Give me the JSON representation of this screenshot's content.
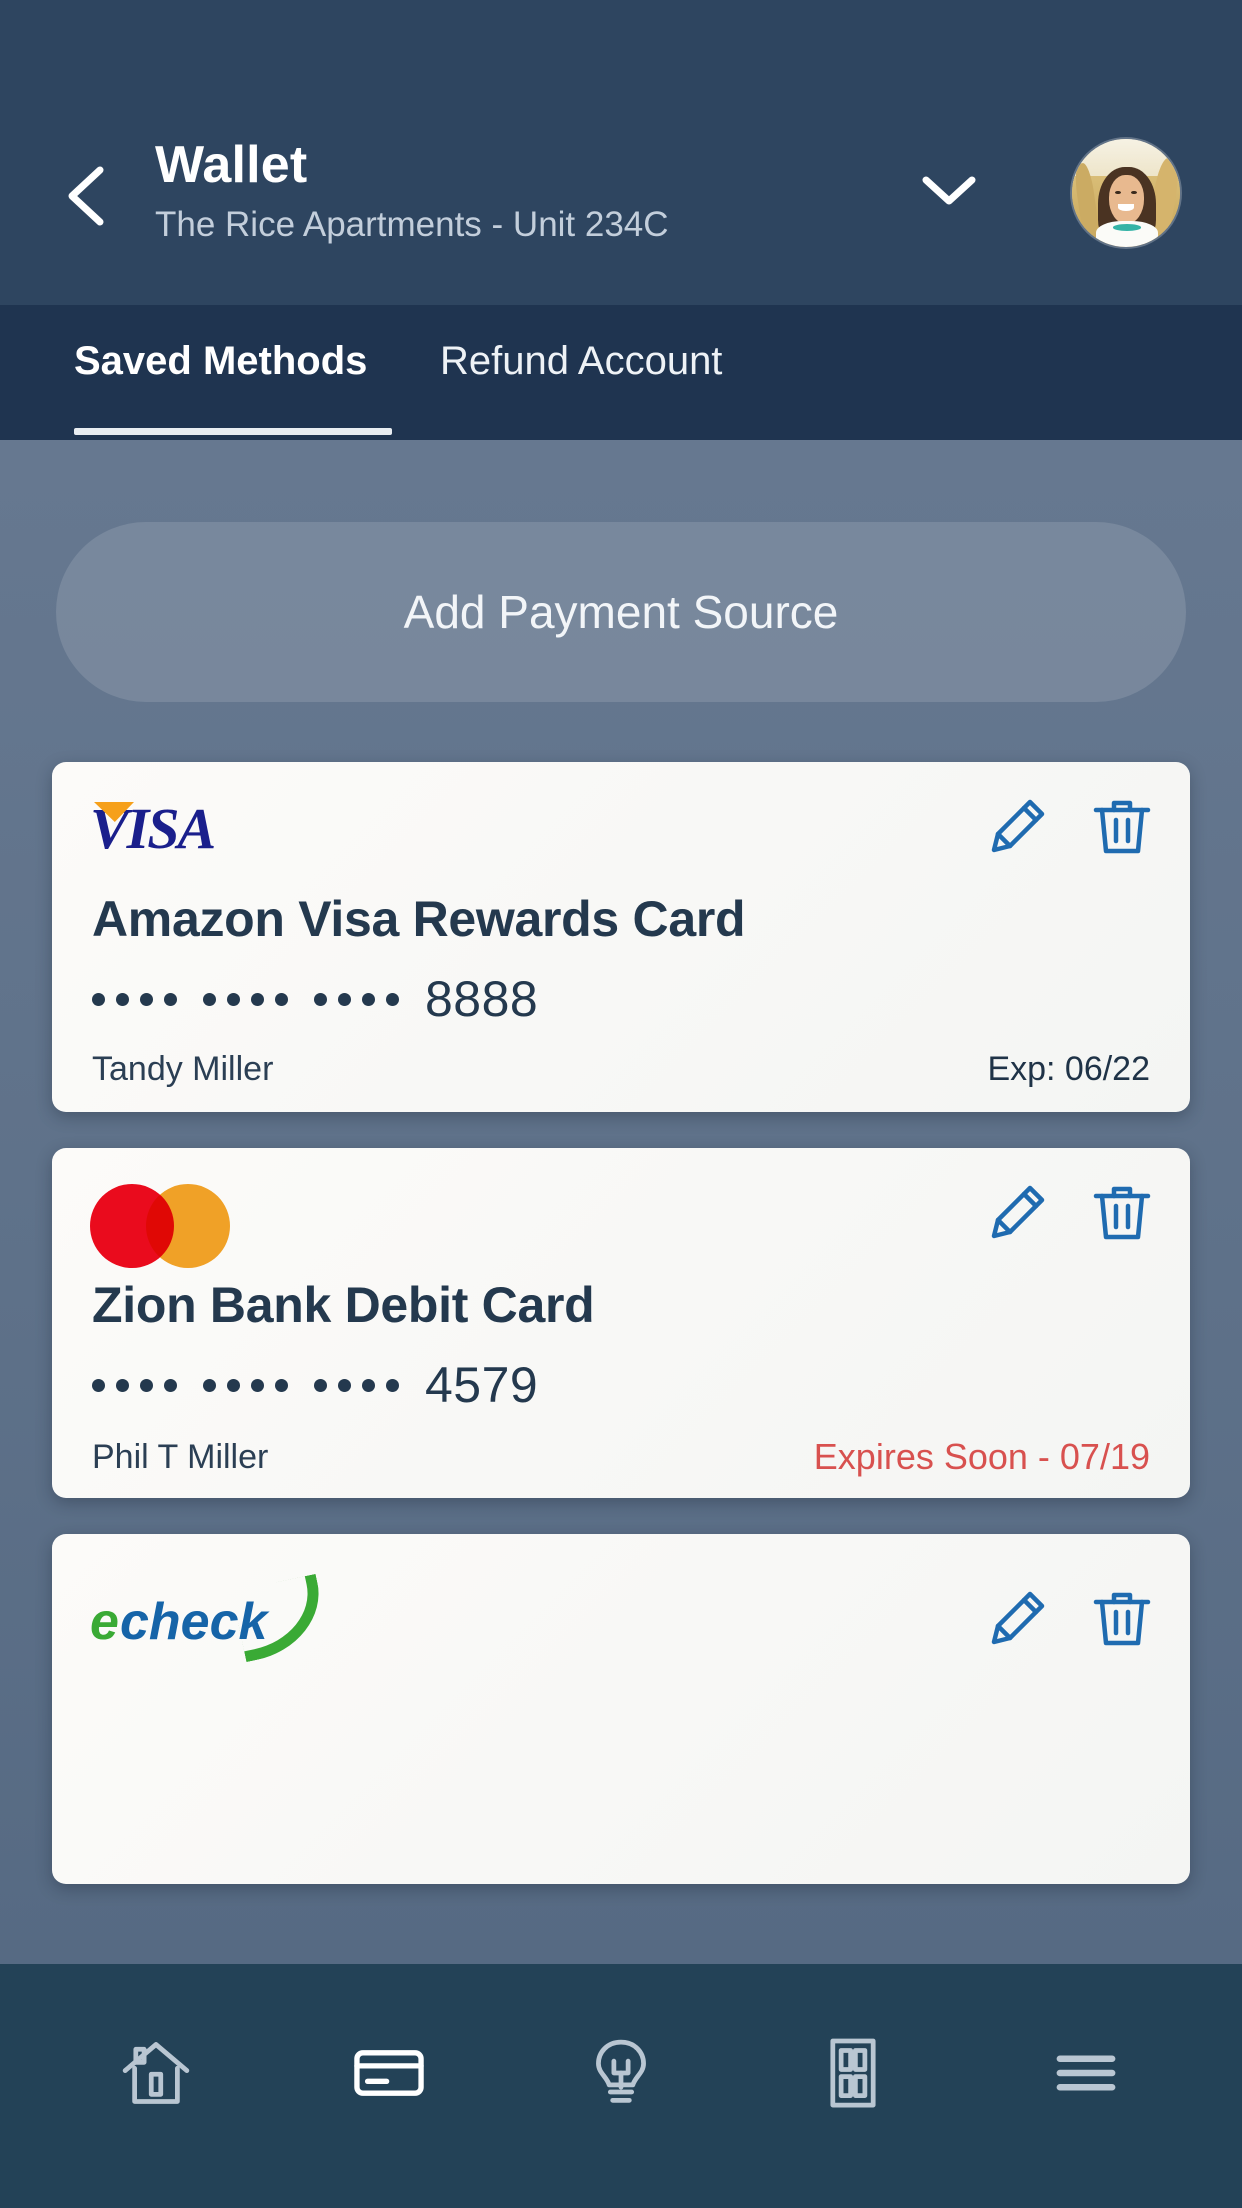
{
  "header": {
    "title": "Wallet",
    "subtitle": "The Rice Apartments - Unit 234C",
    "back_icon": "chevron-left-icon",
    "dropdown_icon": "chevron-down-icon",
    "avatar_icon": "user-avatar-photo"
  },
  "tabs": [
    {
      "label": "Saved Methods",
      "active": true
    },
    {
      "label": "Refund Account",
      "active": false
    }
  ],
  "actions": {
    "add_payment_source": "Add Payment Source"
  },
  "card_actions": {
    "edit_icon": "pencil-edit-icon",
    "delete_icon": "trash-delete-icon"
  },
  "masked_groups": 3,
  "cards": [
    {
      "brand": "visa",
      "brand_label": "VISA",
      "name": "Amazon Visa Rewards Card",
      "last4": "8888",
      "holder": "Tandy Miller",
      "expiry": "Exp: 06/22",
      "expiry_warning": false
    },
    {
      "brand": "mastercard",
      "brand_label": "Mastercard",
      "name": "Zion Bank Debit Card",
      "last4": "4579",
      "holder": "Phil T Miller",
      "expiry": "Expires Soon - 07/19",
      "expiry_warning": true
    },
    {
      "brand": "echeck",
      "brand_label": "echeck",
      "brand_label_first": "e",
      "brand_label_rest": "check",
      "name": "",
      "last4": "",
      "holder": "",
      "expiry": "",
      "expiry_warning": false
    }
  ],
  "bottom_nav": [
    {
      "icon": "home-icon",
      "active": false
    },
    {
      "icon": "credit-card-icon",
      "active": true
    },
    {
      "icon": "lightbulb-icon",
      "active": false
    },
    {
      "icon": "door-icon",
      "active": false
    },
    {
      "icon": "hamburger-menu-icon",
      "active": false
    }
  ],
  "colors": {
    "header_bg": "#2e4560",
    "tabbar_bg": "#1f3450",
    "content_bg": "#667890",
    "card_bg": "#fbfaf8",
    "accent_blue": "#1f6bb0",
    "text_dark": "#24394e",
    "warning_red": "#d8514f",
    "visa_blue": "#1a1f8c",
    "visa_gold": "#f6a01a",
    "mc_red": "#ea0b1d",
    "mc_yellow": "#f4a428",
    "echeck_green": "#3aaa35",
    "echeck_blue": "#1664a8"
  }
}
